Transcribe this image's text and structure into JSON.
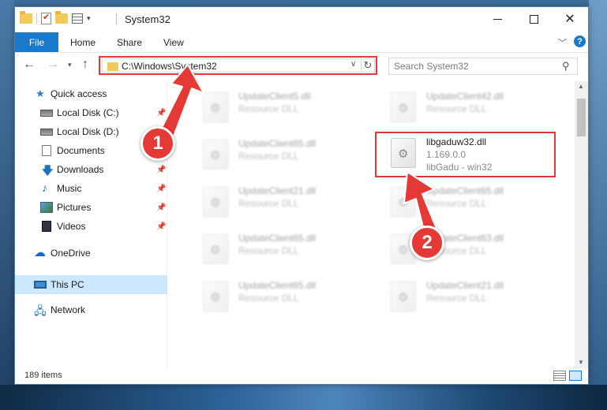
{
  "window": {
    "title": "System32"
  },
  "ribbon": {
    "file_label": "File",
    "tabs": [
      "Home",
      "Share",
      "View"
    ]
  },
  "address": {
    "path": "C:\\Windows\\System32"
  },
  "search": {
    "placeholder": "Search System32"
  },
  "sidebar": {
    "items": [
      {
        "label": "Quick access",
        "icon": "star-icon",
        "pinned": false
      },
      {
        "label": "Local Disk (C:)",
        "icon": "disk-icon",
        "pinned": true
      },
      {
        "label": "Local Disk (D:)",
        "icon": "disk-icon",
        "pinned": false
      },
      {
        "label": "Documents",
        "icon": "documents-icon",
        "pinned": false
      },
      {
        "label": "Downloads",
        "icon": "download-icon",
        "pinned": true
      },
      {
        "label": "Music",
        "icon": "music-icon",
        "pinned": true
      },
      {
        "label": "Pictures",
        "icon": "pictures-icon",
        "pinned": true
      },
      {
        "label": "Videos",
        "icon": "videos-icon",
        "pinned": true
      },
      {
        "label": "OneDrive",
        "icon": "cloud-icon",
        "pinned": false
      },
      {
        "label": "This PC",
        "icon": "pc-icon",
        "pinned": false,
        "selected": true
      },
      {
        "label": "Network",
        "icon": "network-icon",
        "pinned": false
      }
    ]
  },
  "files": [
    {
      "name": "UpdateClient5.dll",
      "sub": "Resource DLL"
    },
    {
      "name": "UpdateClient42.dll",
      "sub": "Resource DLL"
    },
    {
      "name": "UpdateClient65.dll",
      "sub": "Resource DLL"
    },
    {
      "name": "libgaduw32.dll",
      "sub": "1.169.0.0",
      "sub2": "libGadu - win32",
      "highlight": true
    },
    {
      "name": "UpdateClient21.dll",
      "sub": "Resource DLL"
    },
    {
      "name": "UpdateClient65.dll",
      "sub": "Resource DLL"
    },
    {
      "name": "UpdateClient65.dll",
      "sub": "Resource DLL"
    },
    {
      "name": "UpdateClient63.dll",
      "sub": "Resource DLL"
    },
    {
      "name": "UpdateClient65.dll",
      "sub": "Resource DLL"
    },
    {
      "name": "UpdateClient21.dll",
      "sub": "Resource DLL"
    }
  ],
  "status": {
    "item_count": "189 items"
  },
  "annotations": {
    "step1": "1",
    "step2": "2",
    "color": "#e53935"
  }
}
